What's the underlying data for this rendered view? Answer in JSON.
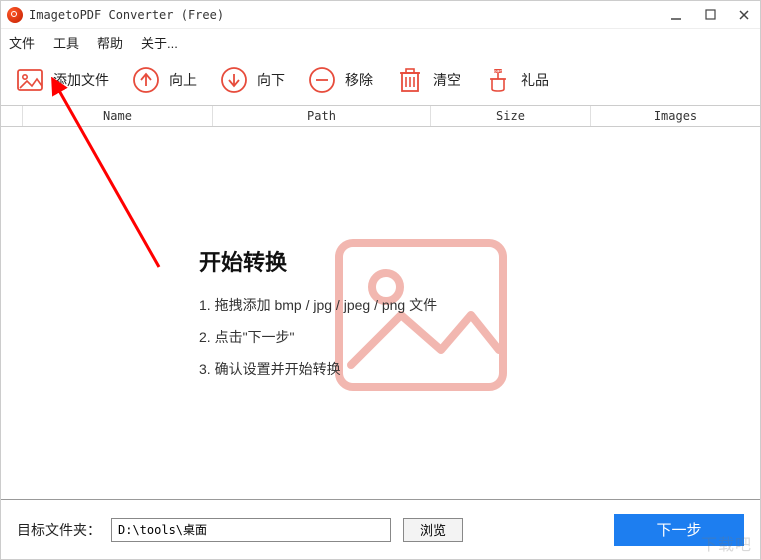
{
  "window": {
    "title": "ImagetoPDF Converter (Free)"
  },
  "menu": {
    "file": "文件",
    "tools": "工具",
    "help": "帮助",
    "about": "关于..."
  },
  "toolbar": {
    "add": "添加文件",
    "up": "向上",
    "down": "向下",
    "remove": "移除",
    "clear": "清空",
    "gift": "礼品"
  },
  "table": {
    "name": "Name",
    "path": "Path",
    "size": "Size",
    "images": "Images"
  },
  "guide": {
    "title": "开始转换",
    "step1": "1. 拖拽添加 bmp / jpg / jpeg / png 文件",
    "step2": "2. 点击\"下一步\"",
    "step3": "3. 确认设置并开始转换"
  },
  "footer": {
    "label": "目标文件夹：",
    "path": "D:\\tools\\桌面",
    "browse": "浏览",
    "next": "下一步"
  },
  "watermark": "下载吧",
  "colors": {
    "accent_red": "#e74c3c",
    "accent_blue": "#1d7ef0"
  }
}
